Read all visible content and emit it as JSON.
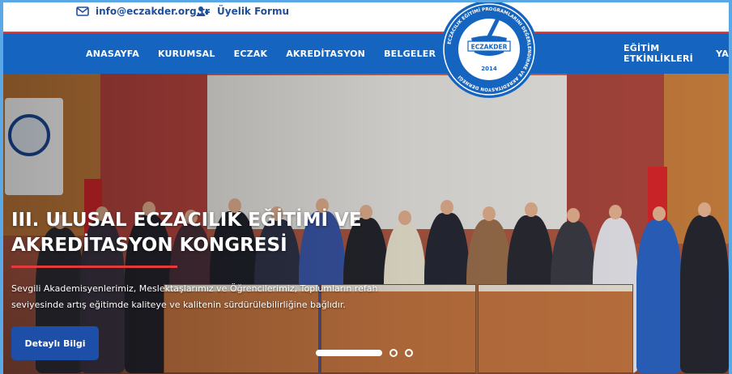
{
  "topbar": {
    "email": "info@eczakder.org.tr",
    "membership_form": "Üyelik Formu"
  },
  "nav": {
    "left": [
      "ANASAYFA",
      "KURUMSAL",
      "ECZAK",
      "AKREDİTASYON",
      "BELGELER"
    ],
    "right": [
      "EĞİTİM ETKİNLİKLERİ",
      "YA"
    ]
  },
  "logo": {
    "ring_text": "ECZACILIK EĞİTİMİ PROGRAMLARINI DEĞERLENDİRME VE AKREDİTASYON DERNEĞİ",
    "name": "ECZAKDER",
    "year": "2014",
    "colors": {
      "ring": "#1565c0",
      "inner": "#ffffff"
    }
  },
  "hero": {
    "title_line1": "III. ULUSAL ECZACILIK EĞİTİMİ VE",
    "title_line2": "AKREDİTASYON KONGRESİ",
    "description": "Sevgili Akademisyenlerimiz, Meslektaşlarımız ve Öğrencilerimiz, Toplumların refah seviyesinde artış eğitimde kaliteye ve kalitenin sürdürülebilirliğine bağlıdır.",
    "button": "Detaylı Bilgi",
    "slides_total": 3,
    "slide_active": 1
  },
  "colors": {
    "brand_blue": "#1565c0",
    "accent_red": "#e23b3b",
    "button_blue": "#1e4fa8"
  }
}
